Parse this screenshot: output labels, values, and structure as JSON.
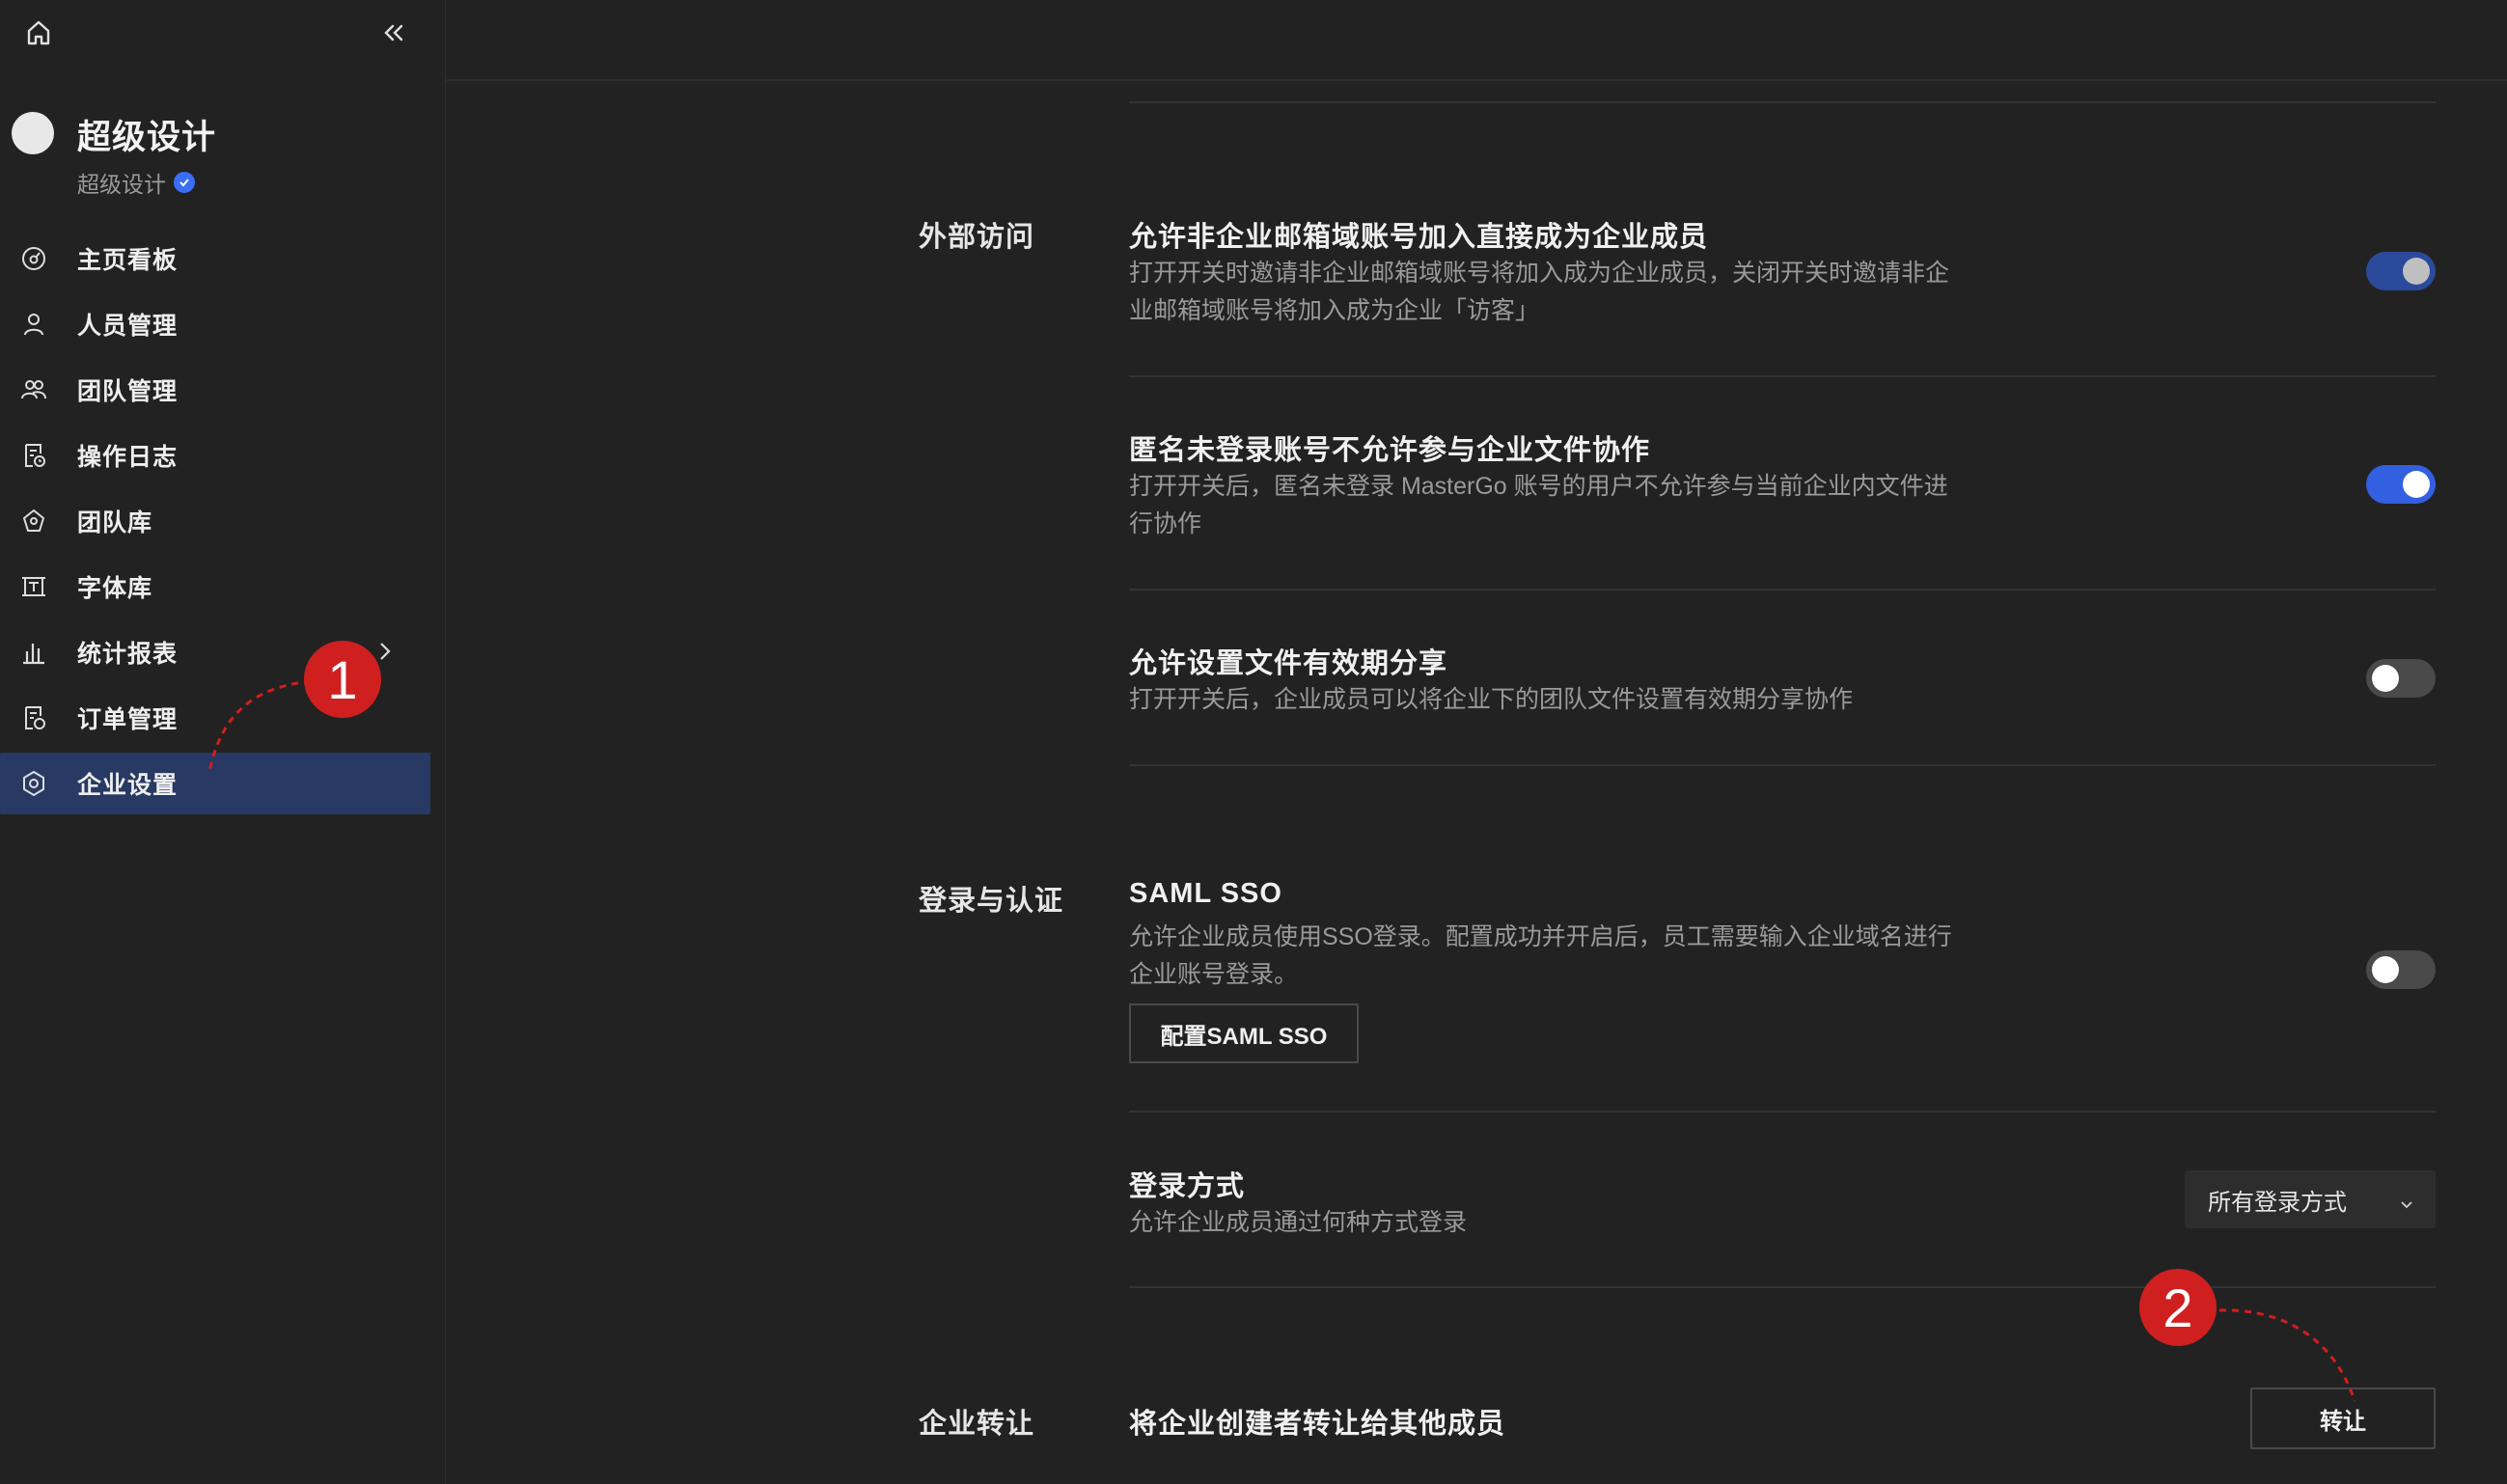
{
  "sidebar": {
    "home_icon": "home-icon",
    "collapse_icon": "double-chevron-left-icon",
    "team_name": "超级设计",
    "team_subtitle": "超级设计",
    "items": [
      {
        "label": "主页看板",
        "icon": "dashboard-icon"
      },
      {
        "label": "人员管理",
        "icon": "user-icon"
      },
      {
        "label": "团队管理",
        "icon": "team-icon"
      },
      {
        "label": "操作日志",
        "icon": "log-icon"
      },
      {
        "label": "团队库",
        "icon": "library-icon"
      },
      {
        "label": "字体库",
        "icon": "font-icon"
      },
      {
        "label": "统计报表",
        "icon": "bar-chart-icon"
      },
      {
        "label": "订单管理",
        "icon": "order-icon"
      },
      {
        "label": "企业设置",
        "icon": "settings-icon",
        "active": true
      }
    ]
  },
  "sections": {
    "external_access": {
      "title": "外部访问",
      "settings": [
        {
          "title": "允许非企业邮箱域账号加入直接成为企业成员",
          "desc": "打开开关时邀请非企业邮箱域账号将加入成为企业成员，关闭开关时邀请非企业邮箱域账号将加入成为企业「访客」",
          "enabled": true
        },
        {
          "title": "匿名未登录账号不允许参与企业文件协作",
          "desc": "打开开关后，匿名未登录 MasterGo 账号的用户不允许参与当前企业内文件进行协作",
          "enabled": true
        },
        {
          "title": "允许设置文件有效期分享",
          "desc": "打开开关后，企业成员可以将企业下的团队文件设置有效期分享协作",
          "enabled": false
        }
      ]
    },
    "login_auth": {
      "title": "登录与认证",
      "saml": {
        "title": "SAML SSO",
        "desc": "允许企业成员使用SSO登录。配置成功并开启后，员工需要输入企业域名进行企业账号登录。",
        "button": "配置SAML SSO",
        "enabled": false
      },
      "login_method": {
        "title": "登录方式",
        "desc": "允许企业成员通过何种方式登录",
        "selected": "所有登录方式"
      }
    },
    "transfer": {
      "title": "企业转让",
      "desc": "将企业创建者转让给其他成员",
      "button": "转让"
    }
  },
  "annotations": {
    "marker1": "1",
    "marker2": "2",
    "color": "#d01f1f"
  },
  "colors": {
    "background": "#222222",
    "active_nav": "#283963",
    "toggle_on": "#3360e0",
    "verified_badge": "#3b6ef5"
  }
}
